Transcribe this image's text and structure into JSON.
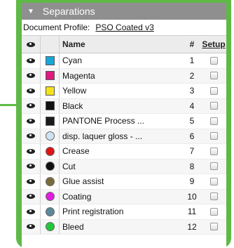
{
  "panel": {
    "title": "Separations"
  },
  "profile": {
    "label": "Document Profile:",
    "value": "PSO Coated v3"
  },
  "columns": {
    "name": "Name",
    "number": "#",
    "setup": "Setup"
  },
  "rows": [
    {
      "name": "Cyan",
      "number": "1",
      "color": "#18a7d9",
      "shape": "square"
    },
    {
      "name": "Magenta",
      "number": "2",
      "color": "#e01880",
      "shape": "square"
    },
    {
      "name": "Yellow",
      "number": "3",
      "color": "#f4e21a",
      "shape": "square"
    },
    {
      "name": "Black",
      "number": "4",
      "color": "#111111",
      "shape": "square"
    },
    {
      "name": "PANTONE Process ...",
      "number": "5",
      "color": "#1a1a1a",
      "shape": "square"
    },
    {
      "name": "disp. laquer gloss - ...",
      "number": "6",
      "color": "#cfe2f3",
      "shape": "circle"
    },
    {
      "name": "Crease",
      "number": "7",
      "color": "#e01414",
      "shape": "circle"
    },
    {
      "name": "Cut",
      "number": "8",
      "color": "#111111",
      "shape": "circle"
    },
    {
      "name": "Glue assist",
      "number": "9",
      "color": "#7a6b3a",
      "shape": "circle"
    },
    {
      "name": "Coating",
      "number": "10",
      "color": "#e21ce0",
      "shape": "circle"
    },
    {
      "name": "Print registration",
      "number": "11",
      "color": "#5a8a9a",
      "shape": "circle"
    },
    {
      "name": "Bleed",
      "number": "12",
      "color": "#22c83a",
      "shape": "circle"
    }
  ],
  "colors": {
    "accent": "#5fb946",
    "titlebar": "#8f8f8f"
  }
}
